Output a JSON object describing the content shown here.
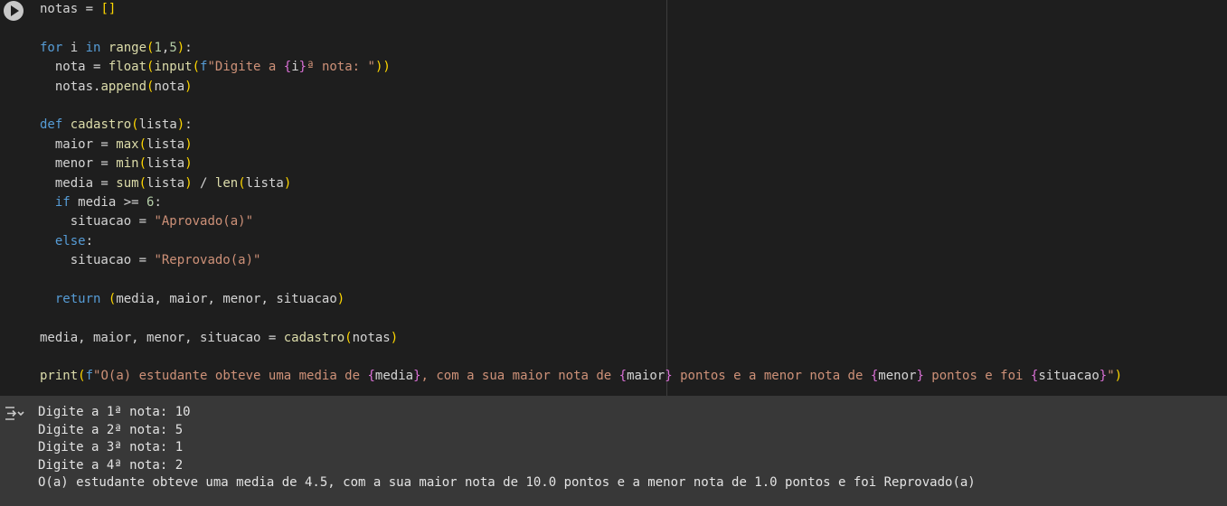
{
  "cell": {
    "code_lines": [
      "notas = []",
      "",
      "for i in range(1,5):",
      "  nota = float(input(f\"Digite a {i}ª nota: \"))",
      "  notas.append(nota)",
      "",
      "def cadastro(lista):",
      "  maior = max(lista)",
      "  menor = min(lista)",
      "  media = sum(lista) / len(lista)",
      "  if media >= 6:",
      "    situacao = \"Aprovado(a)\"",
      "  else:",
      "    situacao = \"Reprovado(a)\"",
      "",
      "  return (media, maior, menor, situacao)",
      "",
      "media, maior, menor, situacao = cadastro(notas)",
      "",
      "print(f\"O(a) estudante obteve uma media de {media}, com a sua maior nota de {maior} pontos e a menor nota de {menor} pontos e foi {situacao}\")"
    ]
  },
  "output": {
    "lines": [
      "Digite a 1ª nota: 10",
      "Digite a 2ª nota: 5",
      "Digite a 3ª nota: 1",
      "Digite a 4ª nota: 2",
      "O(a) estudante obteve uma media de 4.5, com a sua maior nota de 10.0 pontos e a menor nota de 1.0 pontos e foi Reprovado(a)"
    ]
  },
  "colors": {
    "editor_bg": "#1e1e1e",
    "output_bg": "#383838",
    "keyword": "#569cd6",
    "function": "#dcdcaa",
    "string": "#ce9178",
    "number": "#b5cea8",
    "bracket": "#ffd700"
  },
  "icons": {
    "run": "play-circle-icon",
    "output": "output-toggle-icon"
  }
}
